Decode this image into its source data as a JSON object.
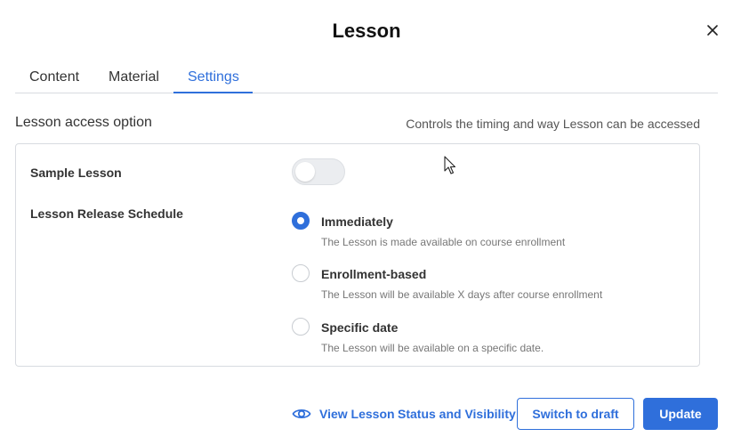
{
  "dialog": {
    "title": "Lesson",
    "close_icon": "close-icon"
  },
  "tabs": [
    {
      "label": "Content",
      "active": false
    },
    {
      "label": "Material",
      "active": false
    },
    {
      "label": "Settings",
      "active": true
    }
  ],
  "section": {
    "title": "Lesson access option",
    "description": "Controls the timing and way Lesson can be accessed"
  },
  "sample_lesson": {
    "label": "Sample Lesson",
    "enabled": false
  },
  "release_schedule": {
    "label": "Lesson Release Schedule",
    "options": [
      {
        "label": "Immediately",
        "description": "The Lesson is made available on course enrollment",
        "selected": true
      },
      {
        "label": "Enrollment-based",
        "description": "The Lesson will be available X days after course enrollment",
        "selected": false
      },
      {
        "label": "Specific date",
        "description": "The Lesson will be available on a specific date.",
        "selected": false
      }
    ]
  },
  "footer": {
    "view_lesson_label": "View Lesson",
    "view_icon": "eye-icon",
    "status_visibility_label": "Status and Visibility",
    "switch_draft_label": "Switch to draft",
    "update_label": "Update"
  },
  "colors": {
    "accent": "#2f6fdb",
    "border": "#d8dbe0",
    "toggle_off": "#ebedf0"
  }
}
